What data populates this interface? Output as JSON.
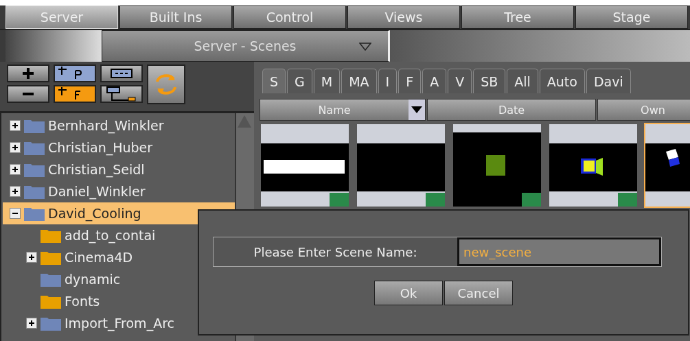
{
  "main_tabs": [
    {
      "label": "Server",
      "selected": true
    },
    {
      "label": "Built Ins",
      "selected": false
    },
    {
      "label": "Control",
      "selected": false
    },
    {
      "label": "Views",
      "selected": false
    },
    {
      "label": "Tree",
      "selected": false
    },
    {
      "label": "Stage",
      "selected": false
    }
  ],
  "view_dropdown": {
    "value": "Server - Scenes"
  },
  "tree": [
    {
      "name": "Bernhard_Winkler",
      "kind": "branch",
      "expanded": false,
      "selected": false,
      "color": "#6f86b8"
    },
    {
      "name": "Christian_Huber",
      "kind": "branch",
      "expanded": false,
      "selected": false,
      "color": "#6f86b8"
    },
    {
      "name": "Christian_Seidl",
      "kind": "branch",
      "expanded": false,
      "selected": false,
      "color": "#6f86b8"
    },
    {
      "name": "Daniel_Winkler",
      "kind": "branch",
      "expanded": false,
      "selected": false,
      "color": "#6f86b8"
    },
    {
      "name": "David_Cooling",
      "kind": "branch",
      "expanded": true,
      "selected": true,
      "color": "#6f86b8",
      "children": [
        {
          "name": "add_to_contai",
          "kind": "leaf",
          "selected": false,
          "color": "#e8a000"
        },
        {
          "name": "Cinema4D",
          "kind": "branch",
          "expanded": false,
          "selected": false,
          "color": "#e8a000"
        },
        {
          "name": "dynamic",
          "kind": "leaf",
          "selected": false,
          "color": "#6f86b8"
        },
        {
          "name": "Fonts",
          "kind": "leaf",
          "selected": false,
          "color": "#e8a000"
        },
        {
          "name": "Import_From_Arc",
          "kind": "branch",
          "expanded": false,
          "selected": false,
          "color": "#6f86b8"
        }
      ]
    }
  ],
  "filter_tabs": [
    {
      "label": "S",
      "selected": true
    },
    {
      "label": "G",
      "selected": false
    },
    {
      "label": "M",
      "selected": false
    },
    {
      "label": "MA",
      "selected": false
    },
    {
      "label": "I",
      "selected": false
    },
    {
      "label": "F",
      "selected": false
    },
    {
      "label": "A",
      "selected": false
    },
    {
      "label": "V",
      "selected": false
    },
    {
      "label": "SB",
      "selected": false
    },
    {
      "label": "All",
      "selected": false
    },
    {
      "label": "Auto",
      "selected": false
    },
    {
      "label": "Davi",
      "selected": false
    }
  ],
  "columns": [
    "Name",
    "Date",
    "Own"
  ],
  "thumbnails": [
    {
      "selected": false
    },
    {
      "selected": false
    },
    {
      "selected": false
    },
    {
      "selected": false
    },
    {
      "selected": true
    }
  ],
  "dialog": {
    "label": "Please Enter Scene Name:",
    "value": "new_scene",
    "buttons": [
      "Ok",
      "Cancel"
    ]
  }
}
